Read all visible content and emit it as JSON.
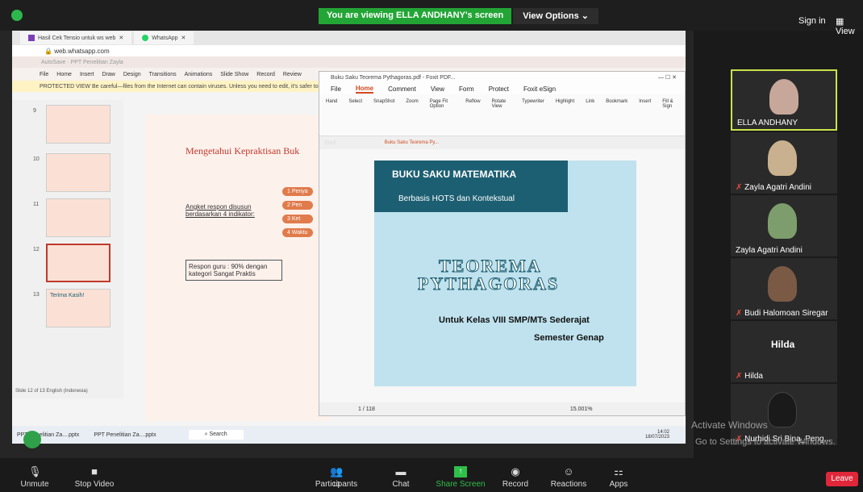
{
  "topbar": {
    "banner": "You are viewing ELLA ANDHANY's screen",
    "view_options": "View Options",
    "sign_in": "Sign in",
    "view": "View"
  },
  "browser": {
    "tabs": [
      {
        "label": "Hasil Cek Tensio untuk ws web"
      },
      {
        "label": "WhatsApp"
      }
    ],
    "url": "web.whatsapp.com",
    "ppt_menu": [
      "File",
      "Home",
      "Insert",
      "Draw",
      "Design",
      "Transitions",
      "Animations",
      "Slide Show",
      "Record",
      "Review"
    ],
    "protected": "PROTECTED VIEW  Be careful—files from the Internet can contain viruses. Unless you need to edit, it's safer to stay",
    "thumbs": [
      "9",
      "10",
      "11",
      "12",
      "13"
    ],
    "thumb_last": "Terima Kasih!",
    "status": "Slide 12 of 13    English (Indonesia)",
    "slide": {
      "title": "Mengetahui Kepraktisan Buk",
      "angket": "Angket respon disusun berdasarkan 4 indikator:",
      "items": [
        "Penya",
        "Pen",
        "Ket",
        "Waktu"
      ],
      "respon": "Respon guru : 90% dengan kategori Sangat Praktis"
    }
  },
  "foxit": {
    "title": "Buku Saku Teorema Pythagoras.pdf - Foxit PDF...",
    "tabs": [
      "File",
      "Home",
      "Comment",
      "View",
      "Form",
      "Protect",
      "Foxit eSign"
    ],
    "ribbon": [
      "Hand",
      "Select",
      "SnapShot",
      "Zoom",
      "Page Fit Option",
      "Reflow",
      "Rotate View",
      "Typewriter",
      "Highlight",
      "Link",
      "Bookmark",
      "Insert",
      "Fill & Sign"
    ],
    "start": "Start",
    "doctab": "Buku Saku Teorema Py...",
    "pdf": {
      "buku": "BUKU SAKU MATEMATIKA",
      "hots": "Berbasis HOTS dan Kontekstual",
      "title1": "TEOREMA",
      "title2": "PYTHAGORAS",
      "kelas": "Untuk Kelas VIII SMP/MTs Sederajat",
      "semester": "Semester Genap"
    },
    "page": "1 / 118",
    "zoom": "15.001%"
  },
  "taskbar": {
    "items": [
      "PPT Penelitian Za....pptx",
      "PPT Penelitian Za....pptx"
    ],
    "search": "Search",
    "time": "14:02",
    "date": "18/07/2023"
  },
  "participants_tiles": [
    "ELLA ANDHANY",
    "Zayla Agatri Andini",
    "Zayla Agatri Andini",
    "Budi Halomoan Siregar",
    "Hilda",
    "Nurhidi Sri Bina_Peng..."
  ],
  "hilda_center": "Hilda",
  "windows": {
    "activate": "Activate Windows",
    "activate_sub": "Go to Settings to activate Windows."
  },
  "bottom": {
    "unmute": "Unmute",
    "stop_video": "Stop Video",
    "participants": "Participants",
    "participants_count": "13",
    "chat": "Chat",
    "share": "Share Screen",
    "record": "Record",
    "reactions": "Reactions",
    "apps": "Apps",
    "leave": "Leave"
  }
}
